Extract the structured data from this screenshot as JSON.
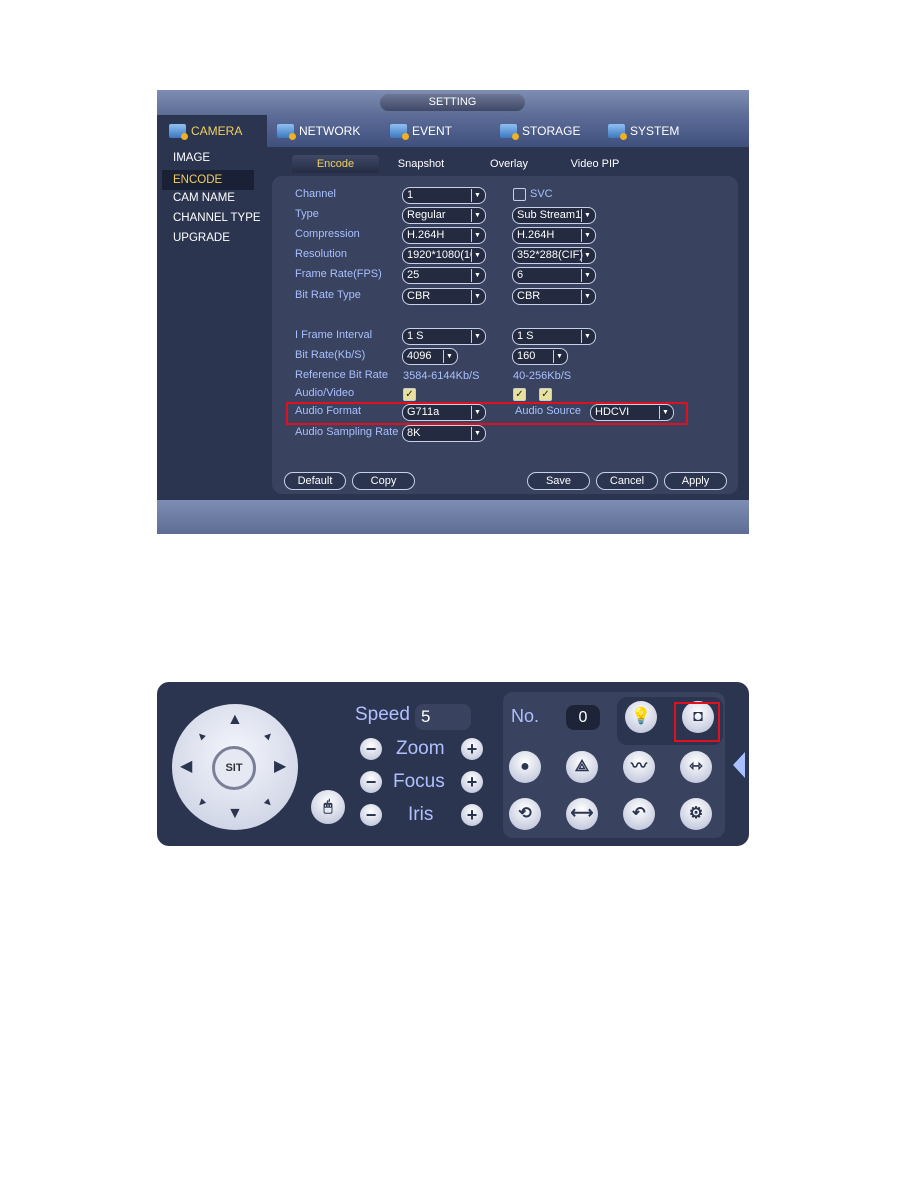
{
  "setting": {
    "title": "SETTING",
    "main_tabs": [
      {
        "label": "CAMERA",
        "icon": "camera-icon"
      },
      {
        "label": "NETWORK",
        "icon": "network-icon"
      },
      {
        "label": "EVENT",
        "icon": "event-icon"
      },
      {
        "label": "STORAGE",
        "icon": "storage-icon"
      },
      {
        "label": "SYSTEM",
        "icon": "system-icon"
      }
    ],
    "left_menu": [
      "IMAGE",
      "ENCODE",
      "CAM NAME",
      "CHANNEL TYPE",
      "UPGRADE"
    ],
    "sub_tabs": [
      "Encode",
      "Snapshot",
      "Overlay",
      "Video PIP"
    ],
    "fields": {
      "channel": {
        "label": "Channel",
        "value": "1"
      },
      "svc": {
        "label": "SVC",
        "checked": false
      },
      "type": {
        "label": "Type",
        "main": "Regular",
        "sub": "Sub Stream1"
      },
      "compression": {
        "label": "Compression",
        "main": "H.264H",
        "sub": "H.264H"
      },
      "resolution": {
        "label": "Resolution",
        "main": "1920*1080(10",
        "sub": "352*288(CIF)"
      },
      "frame_rate": {
        "label": "Frame Rate(FPS)",
        "main": "25",
        "sub": "6"
      },
      "bit_rate_type": {
        "label": "Bit Rate Type",
        "main": "CBR",
        "sub": "CBR"
      },
      "i_frame": {
        "label": "I Frame Interval",
        "main": "1 S",
        "sub": "1 S"
      },
      "bit_rate": {
        "label": "Bit Rate(Kb/S)",
        "main": "4096",
        "sub": "160"
      },
      "ref_bit_rate": {
        "label": "Reference Bit Rate",
        "main": "3584-6144Kb/S",
        "sub": "40-256Kb/S"
      },
      "audio_video": {
        "label": "Audio/Video",
        "main": true,
        "sub1": true,
        "sub2": true
      },
      "audio_format": {
        "label": "Audio Format",
        "value": "G711a"
      },
      "audio_source": {
        "label": "Audio Source",
        "value": "HDCVI"
      },
      "audio_sampling": {
        "label": "Audio Sampling Rate",
        "value": "8K"
      }
    },
    "buttons": {
      "default": "Default",
      "copy": "Copy",
      "save": "Save",
      "cancel": "Cancel",
      "apply": "Apply"
    },
    "highlight_color": "#e01020"
  },
  "ptz": {
    "center_label": "SIT",
    "speed_label": "Speed",
    "speed_value": "5",
    "zoom": "Zoom",
    "focus": "Focus",
    "iris": "Iris",
    "no_label": "No.",
    "no_value": "0",
    "icons": [
      "light-icon",
      "wiper-icon",
      "preset-icon",
      "tour-icon",
      "pattern-icon",
      "scan-icon",
      "rotate-icon",
      "pan-icon",
      "flip-icon",
      "settings-icon"
    ]
  }
}
